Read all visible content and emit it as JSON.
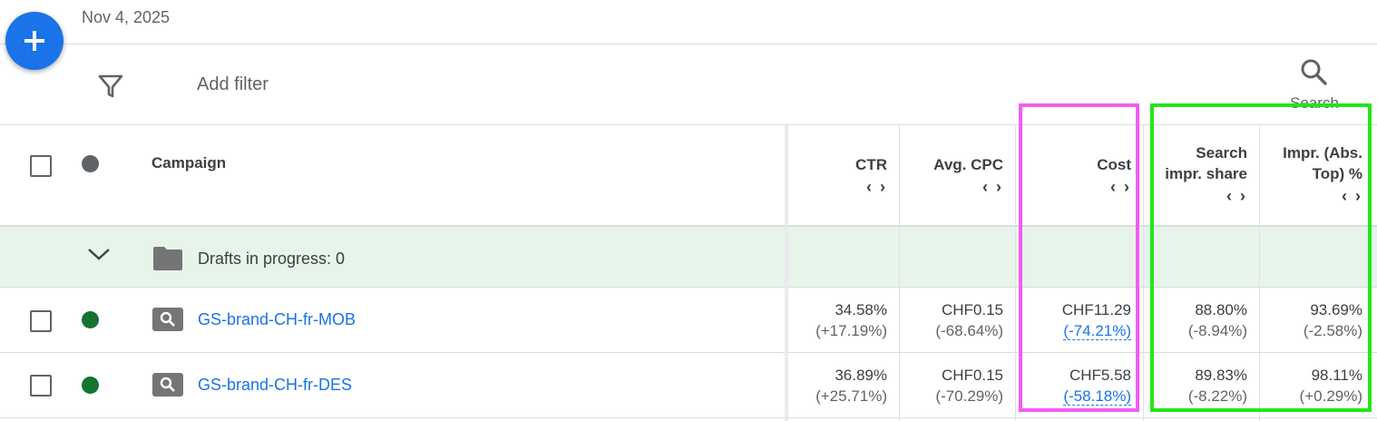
{
  "header": {
    "date": "Nov 4, 2025",
    "add_filter": "Add filter",
    "search_label": "Search"
  },
  "icons": {
    "fab": "plus-icon",
    "filter": "filter-icon",
    "search": "search-icon",
    "expand": "chevron-down-icon",
    "folder": "folder-icon",
    "campaign_type": "search-campaign-icon"
  },
  "colors": {
    "accent": "#1a73e8",
    "status_enabled": "#137333",
    "drafts_row_bg": "#e6f4ea",
    "highlight_pink": "#f25cf2",
    "highlight_green": "#22e61a"
  },
  "table": {
    "columns": {
      "campaign": "Campaign",
      "ctr": "CTR",
      "avg_cpc": "Avg. CPC",
      "cost": "Cost",
      "search_impr_share_1": "Search",
      "search_impr_share_2": "impr. share",
      "impr_abs_top_1": "Impr. (Abs.",
      "impr_abs_top_2": "Top) %",
      "sort_glyph": "‹ ›"
    },
    "drafts": "Drafts in progress: 0",
    "rows": [
      {
        "name": "GS-brand-CH-fr-MOB",
        "ctr": "34.58%",
        "ctr_change": "(+17.19%)",
        "cpc": "CHF0.15",
        "cpc_change": "(-68.64%)",
        "cost": "CHF11.29",
        "cost_change": "(-74.21%)",
        "sis": "88.80%",
        "sis_change": "(-8.94%)",
        "abs": "93.69%",
        "abs_change": "(-2.58%)"
      },
      {
        "name": "GS-brand-CH-fr-DES",
        "ctr": "36.89%",
        "ctr_change": "(+25.71%)",
        "cpc": "CHF0.15",
        "cpc_change": "(-70.29%)",
        "cost": "CHF5.58",
        "cost_change": "(-58.18%)",
        "sis": "89.83%",
        "sis_change": "(-8.22%)",
        "abs": "98.11%",
        "abs_change": "(+0.29%)"
      }
    ]
  }
}
